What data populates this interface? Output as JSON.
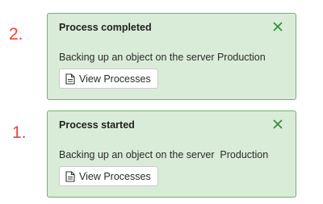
{
  "notifications": [
    {
      "step": "2.",
      "title": "Process completed",
      "message": "Backing up an object on the server Production",
      "button_label": "View Processes"
    },
    {
      "step": "1.",
      "title": "Process started",
      "message": "Backing up an object on the server  Production",
      "button_label": "View Processes"
    }
  ],
  "colors": {
    "step_number": "#e8453c",
    "card_background": "#d9ecd7",
    "card_border": "#6fb36a",
    "close_icon": "#2e8b2e"
  },
  "icons": {
    "close": "close-icon",
    "document": "document-icon"
  }
}
